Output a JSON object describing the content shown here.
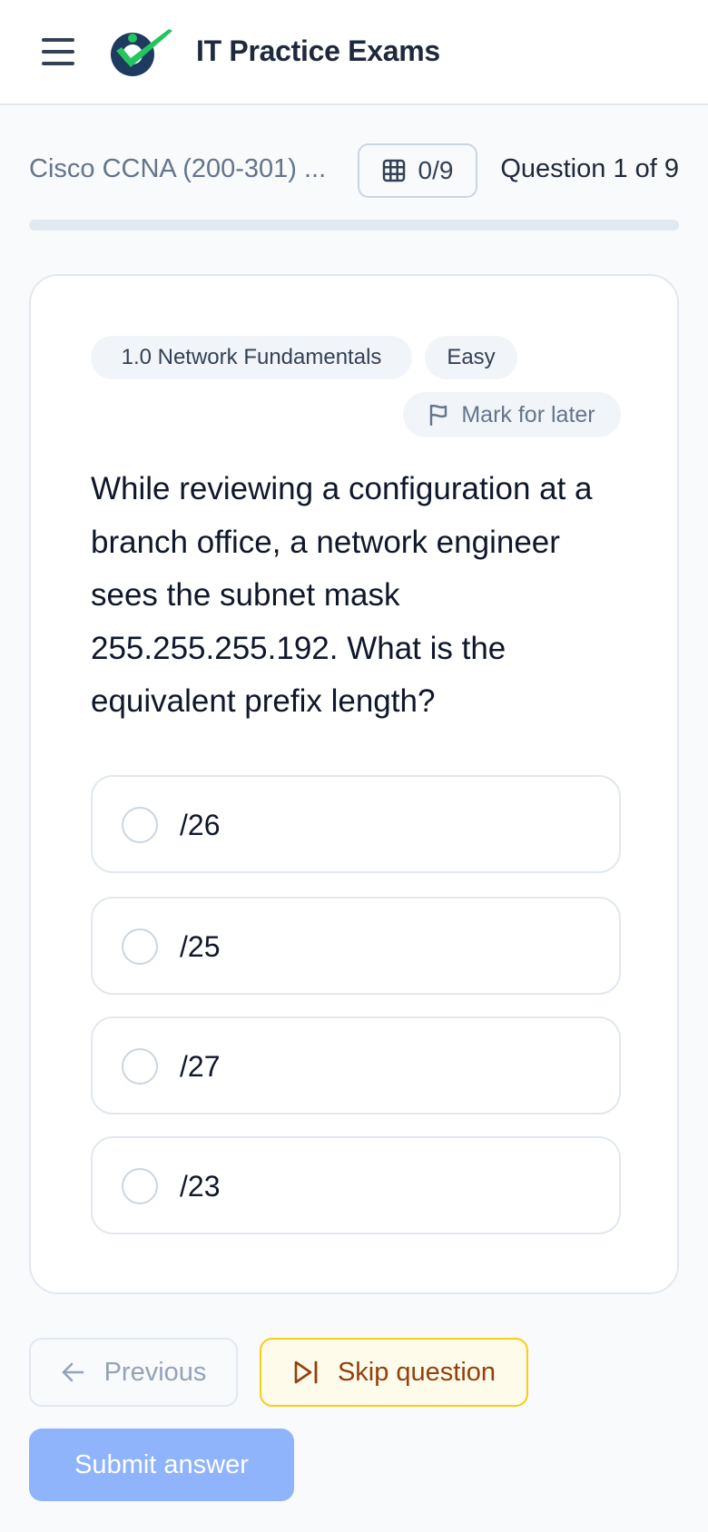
{
  "header": {
    "menu_icon": "hamburger-menu-icon",
    "logo_icon": "checkmark-person-logo",
    "title": "IT Practice Exams"
  },
  "progress": {
    "exam_name": "Cisco CCNA (200-301) ...",
    "grid_icon": "grid-icon",
    "answered_count": "0/9",
    "position_text": "Question 1 of 9",
    "fraction_complete": 0
  },
  "question": {
    "domain_tag": "1.0 Network Fundamentals",
    "difficulty_tag": "Easy",
    "mark_icon": "flag-icon",
    "mark_label": "Mark for later",
    "text": "While reviewing a configuration at a branch office, a network engineer sees the subnet mask 255.255.255.192. What is the equivalent prefix length?",
    "options": [
      {
        "label": "/26",
        "selected": false
      },
      {
        "label": "/25",
        "selected": false
      },
      {
        "label": "/27",
        "selected": false
      },
      {
        "label": "/23",
        "selected": false
      }
    ]
  },
  "actions": {
    "previous_label": "Previous",
    "previous_icon": "arrow-left-icon",
    "skip_label": "Skip question",
    "skip_icon": "skip-forward-icon",
    "submit_label": "Submit answer"
  },
  "colors": {
    "accent": "#3b82f6",
    "submit_disabled": "#8fb4fb",
    "skip_border": "#facc15",
    "skip_text": "#92400e",
    "logo_navy": "#1e3a5f",
    "logo_green": "#22c55e"
  }
}
